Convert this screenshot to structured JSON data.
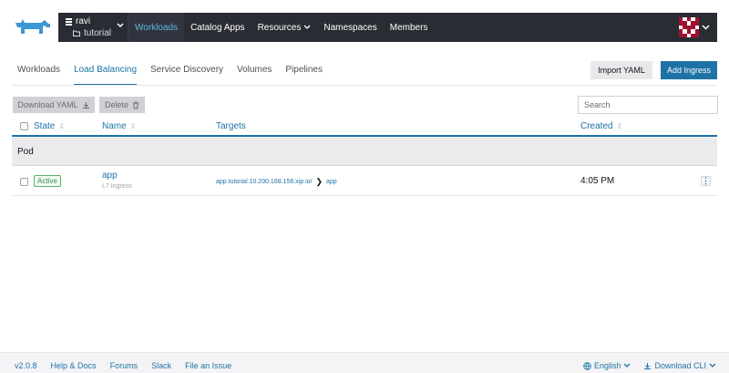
{
  "header": {
    "cluster_name": "ravi",
    "project_name": "tutorial",
    "nav": [
      {
        "label": "Workloads",
        "active": true
      },
      {
        "label": "Catalog Apps"
      },
      {
        "label": "Resources",
        "dropdown": true
      },
      {
        "label": "Namespaces"
      },
      {
        "label": "Members"
      }
    ],
    "accent_color": "#1e72a6",
    "nav_bg": "#2a2c33"
  },
  "tabs": [
    {
      "label": "Workloads"
    },
    {
      "label": "Load Balancing",
      "active": true
    },
    {
      "label": "Service Discovery"
    },
    {
      "label": "Volumes"
    },
    {
      "label": "Pipelines"
    }
  ],
  "actions": {
    "import_yaml": "Import YAML",
    "add_ingress": "Add Ingress",
    "download_yaml": "Download YAML",
    "delete": "Delete",
    "search_placeholder": "Search"
  },
  "table": {
    "columns": [
      "State",
      "Name",
      "Targets",
      "Created"
    ],
    "group_label": "Pod",
    "rows": [
      {
        "state": "Active",
        "name": "app",
        "type": "L7 Ingress",
        "target_host": "app.tutorial.10.200.168.156.xip.io/",
        "target_service": "app",
        "created": "4:05 PM"
      }
    ]
  },
  "footer": {
    "version": "v2.0.8",
    "links": [
      "Help & Docs",
      "Forums",
      "Slack",
      "File an Issue"
    ],
    "language": "English",
    "download_cli": "Download CLI"
  }
}
